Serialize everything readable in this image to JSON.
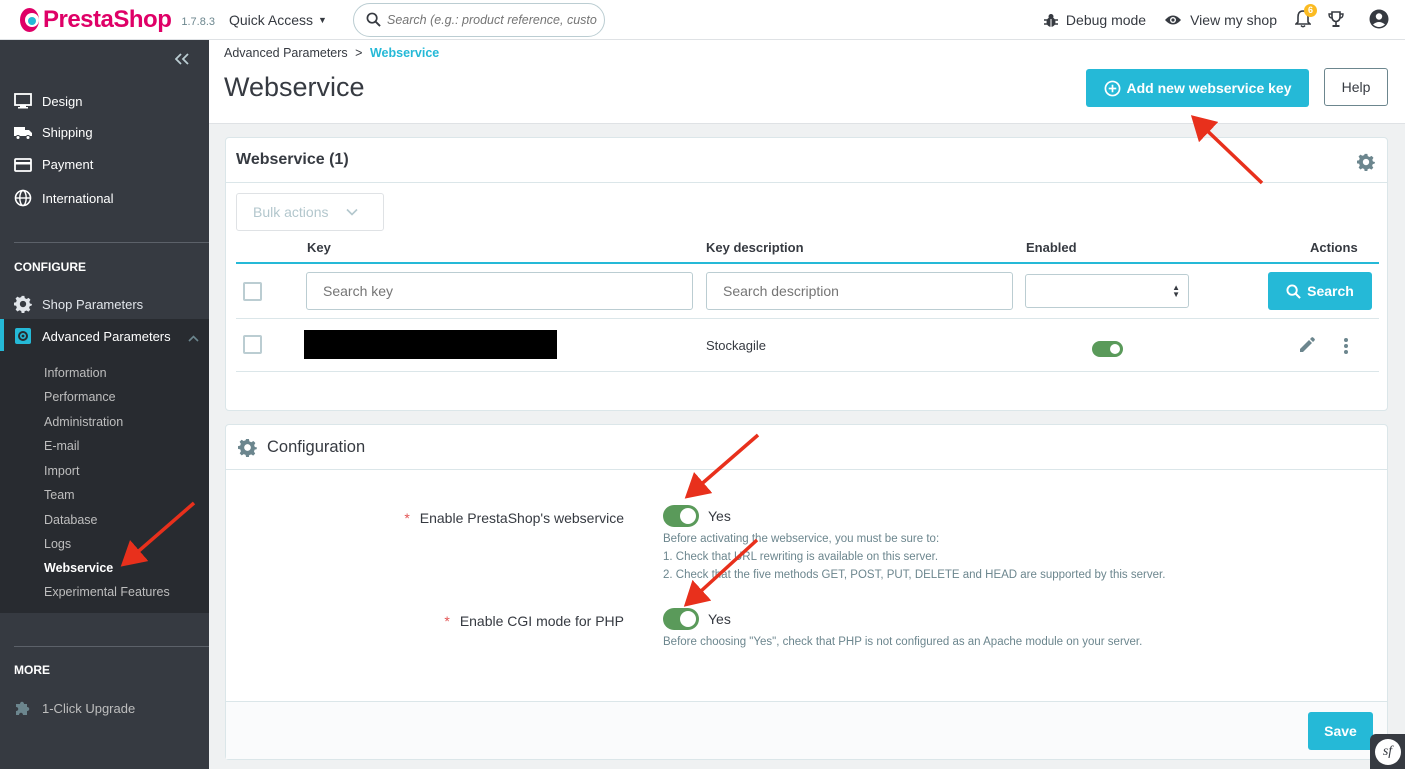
{
  "topbar": {
    "brand": "PrestaShop",
    "version": "1.7.8.3",
    "quick_access": "Quick Access",
    "search_placeholder": "Search (e.g.: product reference, custon",
    "debug_mode": "Debug mode",
    "view_shop": "View my shop",
    "notification_count": "6"
  },
  "sidebar": {
    "items_top": [
      {
        "label": "Design",
        "icon": "monitor-icon"
      },
      {
        "label": "Shipping",
        "icon": "truck-icon"
      },
      {
        "label": "Payment",
        "icon": "credit-card-icon"
      },
      {
        "label": "International",
        "icon": "globe-icon"
      }
    ],
    "configure_heading": "CONFIGURE",
    "shop_parameters": "Shop Parameters",
    "advanced_parameters": "Advanced Parameters",
    "sub_items": [
      "Information",
      "Performance",
      "Administration",
      "E-mail",
      "Import",
      "Team",
      "Database",
      "Logs",
      "Webservice",
      "Experimental Features"
    ],
    "more_heading": "MORE",
    "upgrade": "1-Click Upgrade"
  },
  "header": {
    "breadcrumb_parent": "Advanced Parameters",
    "breadcrumb_separator": ">",
    "breadcrumb_current": "Webservice",
    "title": "Webservice",
    "add_button": "Add new webservice key",
    "help_button": "Help"
  },
  "webservice_list": {
    "title": "Webservice (1)",
    "bulk_actions": "Bulk actions",
    "columns": {
      "key": "Key",
      "description": "Key description",
      "enabled": "Enabled",
      "actions": "Actions"
    },
    "filters": {
      "key_placeholder": "Search key",
      "description_placeholder": "Search description",
      "search_button": "Search"
    },
    "rows": [
      {
        "description": "Stockagile",
        "enabled": true
      }
    ]
  },
  "configuration": {
    "title": "Configuration",
    "fields": [
      {
        "label": "Enable PrestaShop's webservice",
        "value": "Yes",
        "help": [
          "Before activating the webservice, you must be sure to:",
          "1. Check that URL rewriting is available on this server.",
          "2. Check that the five methods GET, POST, PUT, DELETE and HEAD are supported by this server."
        ]
      },
      {
        "label": "Enable CGI mode for PHP",
        "value": "Yes",
        "help": [
          "Before choosing \"Yes\", check that PHP is not configured as an Apache module on your server."
        ]
      }
    ],
    "save_button": "Save"
  },
  "colors": {
    "brand": "#df0067",
    "primary": "#25b9d7",
    "sidebar": "#363a41",
    "toggle_on": "#5a9a5a",
    "annotation_arrow": "#e8301c"
  }
}
